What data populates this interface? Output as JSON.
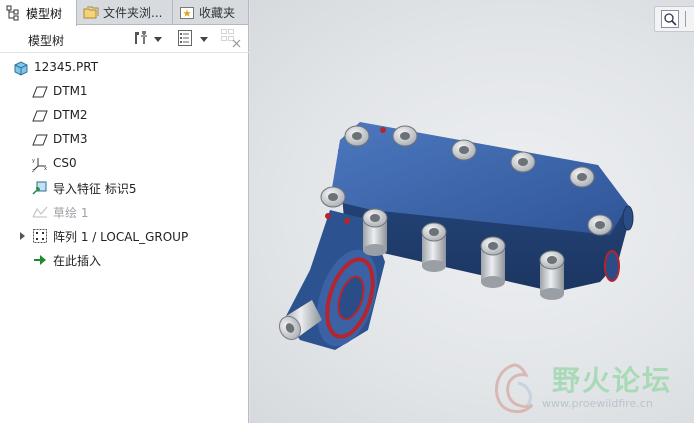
{
  "tabs": [
    {
      "label": "模型树",
      "icon": "model-tree-icon",
      "active": true
    },
    {
      "label": "文件夹浏...",
      "icon": "folder-browser-icon",
      "active": false
    },
    {
      "label": "收藏夹",
      "icon": "favorites-icon",
      "active": false
    }
  ],
  "toolbar": {
    "title": "模型树",
    "settings_icon": "tree-settings-icon",
    "columns_icon": "tree-columns-icon",
    "filter_icon": "show-filter-icon"
  },
  "tree": {
    "root": {
      "label": "12345.PRT",
      "icon": "part-icon"
    },
    "items": [
      {
        "label": "DTM1",
        "icon": "datum-plane-icon",
        "enabled": true
      },
      {
        "label": "DTM2",
        "icon": "datum-plane-icon",
        "enabled": true
      },
      {
        "label": "DTM3",
        "icon": "datum-plane-icon",
        "enabled": true
      },
      {
        "label": "CS0",
        "icon": "coordinate-system-icon",
        "enabled": true
      },
      {
        "label": "导入特征 标识5",
        "icon": "import-feature-icon",
        "enabled": true
      },
      {
        "label": "草绘 1",
        "icon": "sketch-icon",
        "enabled": false
      },
      {
        "label": "阵列 1 / LOCAL_GROUP",
        "icon": "pattern-icon",
        "enabled": true,
        "expandable": true
      },
      {
        "label": "在此插入",
        "icon": "insert-here-arrow-icon",
        "enabled": true
      }
    ]
  },
  "viewport": {
    "view_tool_icon": "zoom-view-icon",
    "model_color": "#3e64a6",
    "boss_color": "#d4d6d8",
    "accent_red": "#b3262f"
  },
  "watermark": {
    "title": "野火论坛",
    "url": "www.proewildfire.cn"
  }
}
